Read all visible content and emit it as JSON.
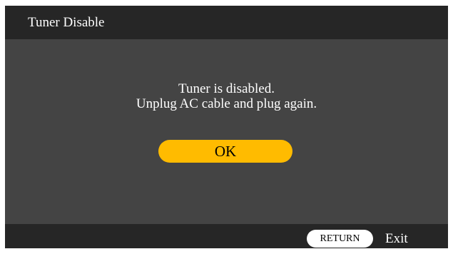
{
  "dialog": {
    "title": "Tuner Disable",
    "message_line1": "Tuner is disabled.",
    "message_line2": "Unplug AC cable and plug again.",
    "ok_label": "OK"
  },
  "footer": {
    "return_key_label": "RETURN",
    "exit_label": "Exit"
  },
  "colors": {
    "panel_background": "#444444",
    "bar_background": "#262626",
    "ok_button": "#ffbb00",
    "text": "#ffffff"
  }
}
